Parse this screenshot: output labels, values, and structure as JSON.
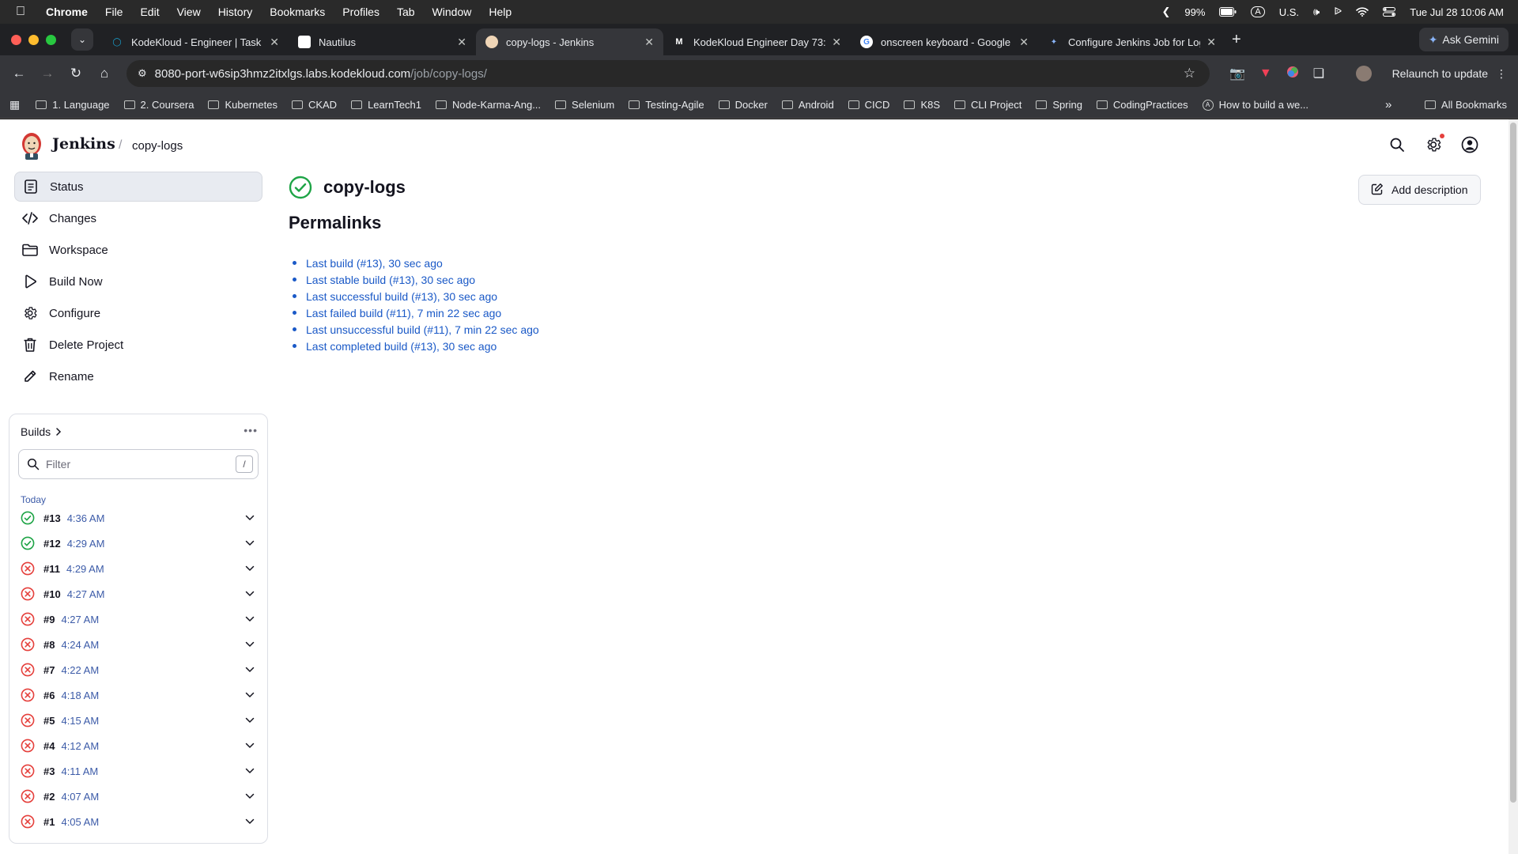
{
  "menubar": {
    "items": [
      "Chrome",
      "File",
      "Edit",
      "View",
      "History",
      "Bookmarks",
      "Profiles",
      "Tab",
      "Window",
      "Help"
    ],
    "battery": "99%",
    "input_source": "U.S.",
    "datetime": "Tue Jul 28  10:06 AM"
  },
  "browser": {
    "tabs": [
      {
        "title": "KodeKloud - Engineer | Task",
        "active": false
      },
      {
        "title": "Nautilus",
        "active": false
      },
      {
        "title": "copy-logs - Jenkins",
        "active": true
      },
      {
        "title": "KodeKloud Engineer Day 73:",
        "active": false
      },
      {
        "title": "onscreen keyboard - Google",
        "active": false
      },
      {
        "title": "Configure Jenkins Job for Log",
        "active": false
      }
    ],
    "ask_gemini": "Ask Gemini",
    "url_host": "8080-port-w6sip3hmz2itxlgs.labs.kodekloud.com",
    "url_path": "/job/copy-logs/",
    "relaunch": "Relaunch to update",
    "bookmarks": [
      "1. Language",
      "2. Coursera",
      "Kubernetes",
      "CKAD",
      "LearnTech1",
      "Node-Karma-Ang...",
      "Selenium",
      "Testing-Agile",
      "Docker",
      "Android",
      "CICD",
      "K8S",
      "CLI Project",
      "Spring",
      "CodingPractices",
      "How to build a we..."
    ],
    "all_bookmarks": "All Bookmarks",
    "more": "»"
  },
  "jenkins": {
    "brand": "Jenkins",
    "breadcrumb_sep": "/",
    "breadcrumb": "copy-logs",
    "nav": [
      "Status",
      "Changes",
      "Workspace",
      "Build Now",
      "Configure",
      "Delete Project",
      "Rename"
    ],
    "job_title": "copy-logs",
    "add_description": "Add description",
    "permalinks_title": "Permalinks",
    "permalinks": [
      "Last build (#13), 30 sec ago",
      "Last stable build (#13), 30 sec ago",
      "Last successful build (#13), 30 sec ago",
      "Last failed build (#11), 7 min 22 sec ago",
      "Last unsuccessful build (#11), 7 min 22 sec ago",
      "Last completed build (#13), 30 sec ago"
    ],
    "builds": {
      "title": "Builds",
      "more": "•••",
      "filter_placeholder": "Filter",
      "filter_shortcut": "/",
      "group": "Today",
      "items": [
        {
          "num": "#13",
          "time": "4:36 AM",
          "status": "success"
        },
        {
          "num": "#12",
          "time": "4:29 AM",
          "status": "success"
        },
        {
          "num": "#11",
          "time": "4:29 AM",
          "status": "failed"
        },
        {
          "num": "#10",
          "time": "4:27 AM",
          "status": "failed"
        },
        {
          "num": "#9",
          "time": "4:27 AM",
          "status": "failed"
        },
        {
          "num": "#8",
          "time": "4:24 AM",
          "status": "failed"
        },
        {
          "num": "#7",
          "time": "4:22 AM",
          "status": "failed"
        },
        {
          "num": "#6",
          "time": "4:18 AM",
          "status": "failed"
        },
        {
          "num": "#5",
          "time": "4:15 AM",
          "status": "failed"
        },
        {
          "num": "#4",
          "time": "4:12 AM",
          "status": "failed"
        },
        {
          "num": "#3",
          "time": "4:11 AM",
          "status": "failed"
        },
        {
          "num": "#2",
          "time": "4:07 AM",
          "status": "failed"
        },
        {
          "num": "#1",
          "time": "4:05 AM",
          "status": "failed"
        }
      ]
    }
  },
  "colors": {
    "success": "#1ea446",
    "failed": "#e5403c",
    "link": "#1a59c7",
    "active_nav": "#e8ebf1"
  }
}
